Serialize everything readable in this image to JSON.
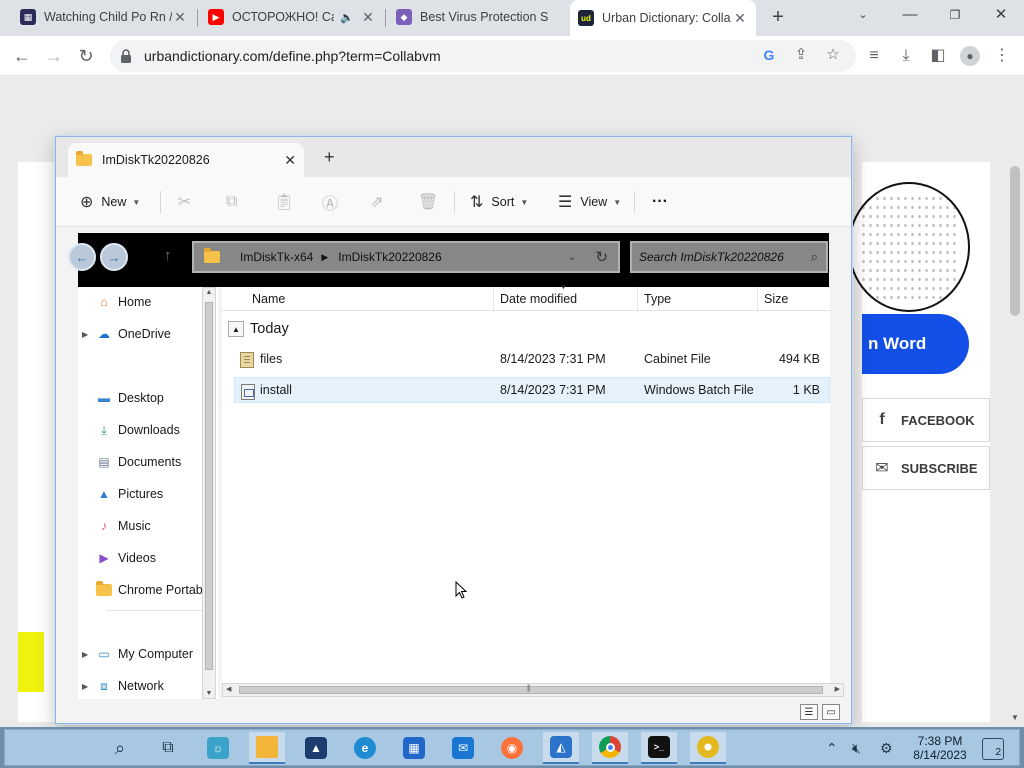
{
  "browser": {
    "tabs": [
      {
        "title": "Watching Child Po Rn /"
      },
      {
        "title": "ОСТОРОЖНО! Ca"
      },
      {
        "title": "Best Virus Protection S"
      },
      {
        "title": "Urban Dictionary: Colla"
      }
    ],
    "url": "urbandictionary.com/define.php?term=Collabvm"
  },
  "webpage": {
    "word_button": "n Word",
    "facebook": "FACEBOOK",
    "subscribe": "SUBSCRIBE"
  },
  "explorer": {
    "tab_title": "ImDiskTk20220826",
    "commands": {
      "new": "New",
      "sort": "Sort",
      "view": "View",
      "more": "···"
    },
    "breadcrumb": [
      "ImDiskTk-x64",
      "ImDiskTk20220826"
    ],
    "search_placeholder": "Search ImDiskTk20220826",
    "nav": {
      "home": "Home",
      "onedrive": "OneDrive",
      "desktop": "Desktop",
      "downloads": "Downloads",
      "documents": "Documents",
      "pictures": "Pictures",
      "music": "Music",
      "videos": "Videos",
      "chrome_portable": "Chrome Portabl",
      "my_computer": "My Computer",
      "network": "Network"
    },
    "columns": {
      "name": "Name",
      "date": "Date modified",
      "type": "Type",
      "size": "Size"
    },
    "group": "Today",
    "files": [
      {
        "name": "files",
        "date": "8/14/2023 7:31 PM",
        "type": "Cabinet File",
        "size": "494 KB"
      },
      {
        "name": "install",
        "date": "8/14/2023 7:31 PM",
        "type": "Windows Batch File",
        "size": "1 KB"
      }
    ]
  },
  "taskbar": {
    "time": "7:38 PM",
    "date": "8/14/2023",
    "notifications": "2"
  }
}
